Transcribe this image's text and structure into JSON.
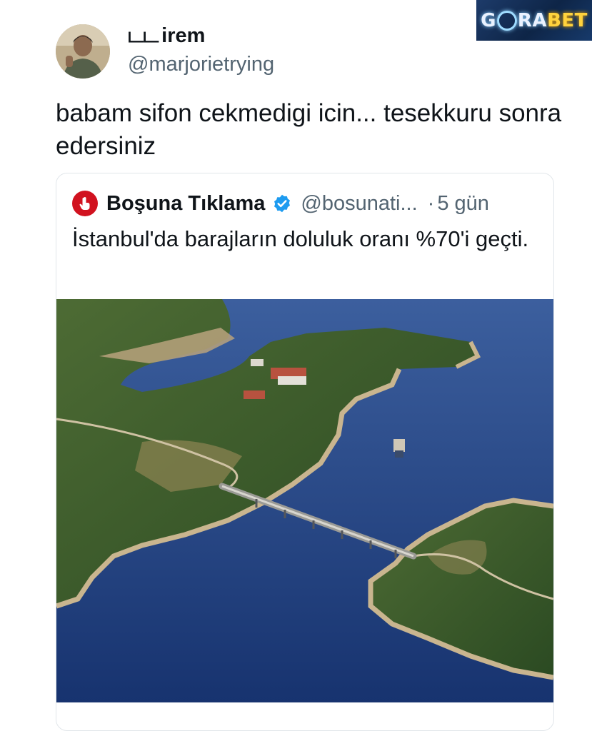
{
  "watermark": {
    "part1": "G",
    "part2": "RA",
    "part3": "BET"
  },
  "tweet": {
    "display_name": "irem",
    "name_prefix_glyph": "டட",
    "handle": "@marjorietrying",
    "text": "babam sifon cekmedigi icin... tesekkuru sonra edersiniz"
  },
  "quote": {
    "display_name": "Boşuna Tıklama",
    "handle": "@bosunati...",
    "separator": "·",
    "time": "5 gün",
    "text": "İstanbul'da barajların doluluk oranı %70'i geçti.",
    "verified_color": "#1d9bf0",
    "avatar_color": "#d1121f"
  }
}
